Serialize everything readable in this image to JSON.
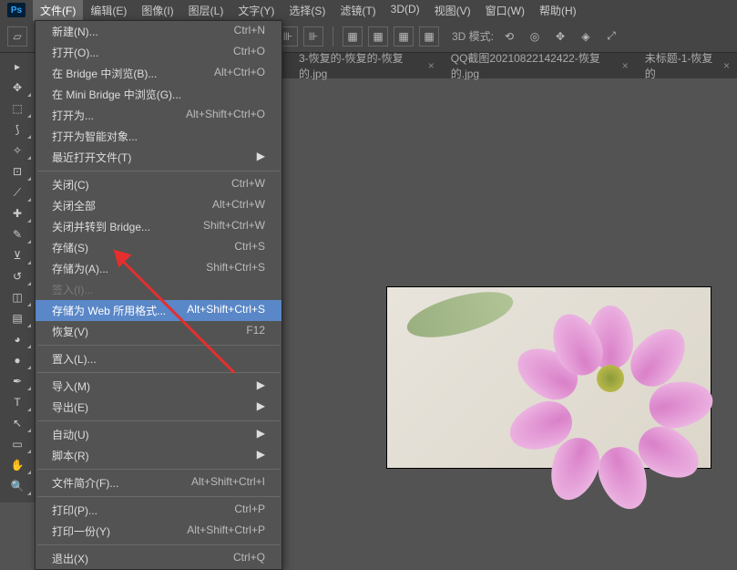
{
  "app": {
    "logo": "Ps"
  },
  "menu": {
    "items": [
      "文件(F)",
      "编辑(E)",
      "图像(I)",
      "图层(L)",
      "文字(Y)",
      "选择(S)",
      "滤镜(T)",
      "3D(D)",
      "视图(V)",
      "窗口(W)",
      "帮助(H)"
    ],
    "active_index": 0
  },
  "options_bar": {
    "mode_label": "3D 模式:"
  },
  "tabs": [
    {
      "label": "3-恢复的-恢复的-恢复的.jpg"
    },
    {
      "label": "QQ截图20210822142422-恢复的.jpg"
    },
    {
      "label": "未标题-1-恢复的"
    }
  ],
  "dropdown": {
    "groups": [
      [
        {
          "label": "新建(N)...",
          "shortcut": "Ctrl+N"
        },
        {
          "label": "打开(O)...",
          "shortcut": "Ctrl+O"
        },
        {
          "label": "在 Bridge 中浏览(B)...",
          "shortcut": "Alt+Ctrl+O"
        },
        {
          "label": "在 Mini Bridge 中浏览(G)..."
        },
        {
          "label": "打开为...",
          "shortcut": "Alt+Shift+Ctrl+O"
        },
        {
          "label": "打开为智能对象..."
        },
        {
          "label": "最近打开文件(T)",
          "submenu": true
        }
      ],
      [
        {
          "label": "关闭(C)",
          "shortcut": "Ctrl+W"
        },
        {
          "label": "关闭全部",
          "shortcut": "Alt+Ctrl+W"
        },
        {
          "label": "关闭并转到 Bridge...",
          "shortcut": "Shift+Ctrl+W"
        },
        {
          "label": "存储(S)",
          "shortcut": "Ctrl+S"
        },
        {
          "label": "存储为(A)...",
          "shortcut": "Shift+Ctrl+S"
        },
        {
          "label": "签入(I)...",
          "disabled": true
        },
        {
          "label": "存储为 Web 所用格式...",
          "shortcut": "Alt+Shift+Ctrl+S",
          "highlight": true
        },
        {
          "label": "恢复(V)",
          "shortcut": "F12"
        }
      ],
      [
        {
          "label": "置入(L)..."
        }
      ],
      [
        {
          "label": "导入(M)",
          "submenu": true
        },
        {
          "label": "导出(E)",
          "submenu": true
        }
      ],
      [
        {
          "label": "自动(U)",
          "submenu": true
        },
        {
          "label": "脚本(R)",
          "submenu": true
        }
      ],
      [
        {
          "label": "文件简介(F)...",
          "shortcut": "Alt+Shift+Ctrl+I"
        }
      ],
      [
        {
          "label": "打印(P)...",
          "shortcut": "Ctrl+P"
        },
        {
          "label": "打印一份(Y)",
          "shortcut": "Alt+Shift+Ctrl+P"
        }
      ],
      [
        {
          "label": "退出(X)",
          "shortcut": "Ctrl+Q"
        }
      ]
    ]
  },
  "tools": [
    "move",
    "marquee",
    "lasso",
    "wand",
    "crop",
    "eyedropper",
    "heal",
    "brush",
    "stamp",
    "history",
    "eraser",
    "gradient",
    "blur",
    "dodge",
    "pen",
    "type",
    "path",
    "rect",
    "hand",
    "zoom"
  ]
}
